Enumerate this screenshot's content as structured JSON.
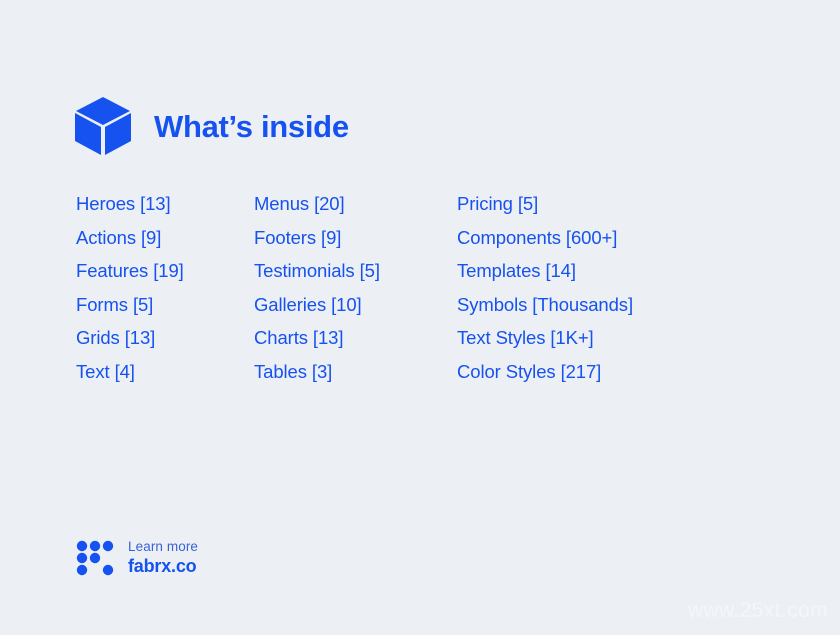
{
  "theme": {
    "background": "#eceff4",
    "brand_blue": "#1652f0",
    "muted_blue": "#3a63d8",
    "watermark_color": "#f4f6fa"
  },
  "header": {
    "icon": "cube-icon",
    "title": "What’s inside"
  },
  "columns": [
    {
      "items": [
        "Heroes [13]",
        "Actions [9]",
        "Features [19]",
        "Forms [5]",
        "Grids [13]",
        "Text [4]"
      ]
    },
    {
      "items": [
        "Menus [20]",
        "Footers [9]",
        "Testimonials [5]",
        "Galleries [10]",
        "Charts [13]",
        "Tables [3]"
      ]
    },
    {
      "items": [
        "Pricing [5]",
        "Components [600+]",
        "Templates [14]",
        "Symbols [Thousands]",
        "Text Styles [1K+]",
        "Color Styles [217]"
      ]
    }
  ],
  "footer": {
    "logo": "dots-grid-icon",
    "learn_more": "Learn more",
    "url": "fabrx.co"
  },
  "watermark": {
    "text": "www.25xt.com"
  }
}
